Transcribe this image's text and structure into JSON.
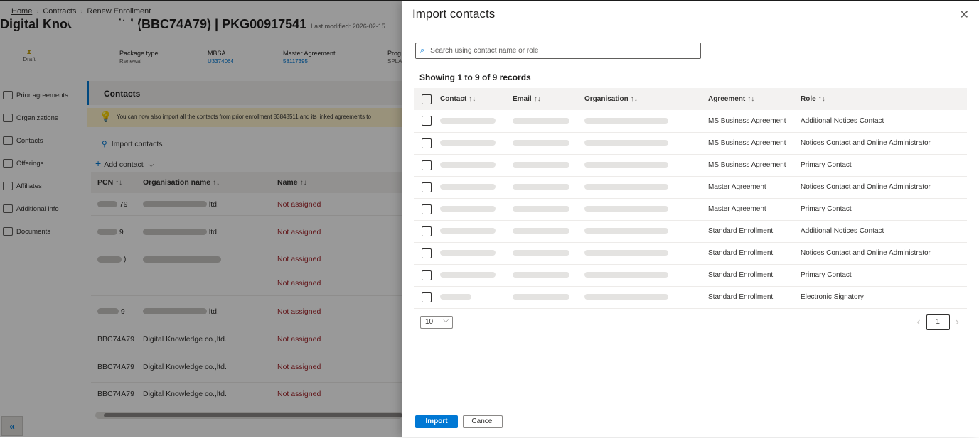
{
  "breadcrumb": {
    "home": "Home",
    "contracts": "Contracts",
    "current": "Renew Enrollment"
  },
  "page": {
    "title_visible": "Digital Knowle",
    "title_id": "ltd (BBC74A79) | PKG00917541",
    "last_modified": "Last modified: 2026-02-15"
  },
  "package": {
    "status": "Draft",
    "fields": [
      {
        "label": "Package type",
        "value": "Renewal"
      },
      {
        "label": "MBSA",
        "value": "U3374064"
      },
      {
        "label": "Master Agreement",
        "value": "58117395"
      },
      {
        "label": "Prog",
        "value": "SPLA"
      }
    ]
  },
  "nav": [
    "Prior agreements",
    "Organizations",
    "Contacts",
    "Offerings",
    "Affiliates",
    "Additional info",
    "Documents"
  ],
  "contacts_section": {
    "title": "Contacts",
    "banner": "You can now also import all the contacts from prior enrollment 83848511 and its linked agreements to",
    "import_link": "Import contacts",
    "add_contact": "Add contact",
    "columns": [
      "PCN",
      "Organisation name",
      "Name"
    ],
    "rows": [
      {
        "pcn": "79",
        "org": "ltd.",
        "name": "Not assigned"
      },
      {
        "pcn": "9",
        "org": "ltd.",
        "name": "Not assigned"
      },
      {
        "pcn": ")",
        "org": "",
        "name": "Not assigned"
      },
      {
        "pcn": "",
        "org": "",
        "name": "Not assigned"
      },
      {
        "pcn": "9",
        "org": "ltd.",
        "name": "Not assigned"
      },
      {
        "pcn": "BBC74A79",
        "org": "Digital Knowledge co.,ltd.",
        "name": "Not assigned"
      },
      {
        "pcn": "BBC74A79",
        "org": "Digital Knowledge co.,ltd.",
        "name": "Not assigned"
      },
      {
        "pcn": "BBC74A79",
        "org": "Digital Knowledge co.,ltd.",
        "name": "Not assigned"
      }
    ]
  },
  "panel": {
    "title": "Import contacts",
    "search_placeholder": "Search using contact name or role",
    "records_text": "Showing 1 to 9 of 9 records",
    "columns": [
      "Contact",
      "Email",
      "Organisation",
      "Agreement",
      "Role"
    ],
    "rows": [
      {
        "agreement": "MS Business Agreement",
        "role": "Additional Notices Contact"
      },
      {
        "agreement": "MS Business Agreement",
        "role": "Notices Contact and Online Administrator"
      },
      {
        "agreement": "MS Business Agreement",
        "role": "Primary Contact"
      },
      {
        "agreement": "Master Agreement",
        "role": "Notices Contact and Online Administrator"
      },
      {
        "agreement": "Master Agreement",
        "role": "Primary Contact"
      },
      {
        "agreement": "Standard Enrollment",
        "role": "Additional Notices Contact"
      },
      {
        "agreement": "Standard Enrollment",
        "role": "Notices Contact and Online Administrator"
      },
      {
        "agreement": "Standard Enrollment",
        "role": "Primary Contact"
      },
      {
        "agreement": "Standard Enrollment",
        "role": "Electronic Signatory"
      }
    ],
    "page_size": "10",
    "current_page": "1",
    "import_button": "Import",
    "cancel_button": "Cancel"
  },
  "icons": {
    "sort": "↑↓",
    "search": "⌕",
    "close": "✕",
    "chevron_down": "⌵",
    "prev": "‹",
    "next": "›",
    "collapse": "«",
    "add": "+",
    "person_add": "⚲",
    "bulb": "💡",
    "hourglass": "⧗"
  },
  "colors": {
    "accent": "#0078d4",
    "warning_bg": "#fff4ce",
    "danger_text": "#a4262c"
  }
}
